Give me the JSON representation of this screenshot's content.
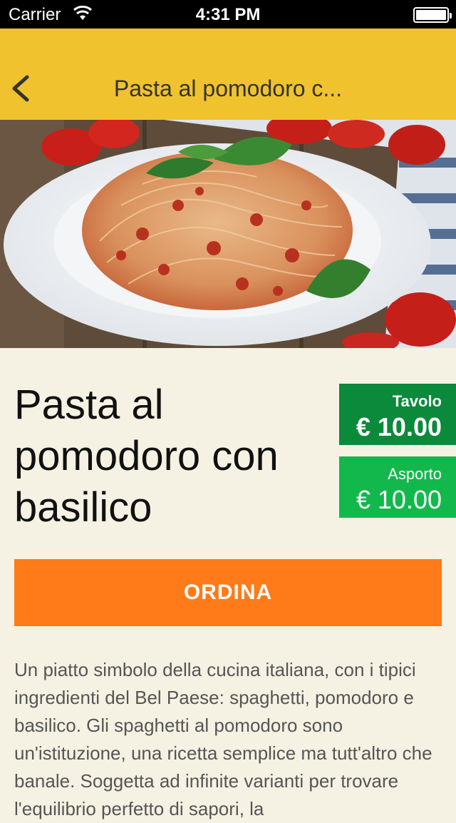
{
  "status_bar": {
    "carrier": "Carrier",
    "time": "4:31 PM"
  },
  "nav": {
    "title": "Pasta al pomodoro c...",
    "back_icon": "chevron-left-icon"
  },
  "hero": {
    "image_alt": ""
  },
  "dish": {
    "title": "Pasta al pomodoro con basilico"
  },
  "prices": {
    "table": {
      "label": "Tavolo",
      "value": "€ 10.00"
    },
    "takeaway": {
      "label": "Asporto",
      "value": "€ 10.00"
    }
  },
  "order_button": {
    "label": "ORDINA"
  },
  "description": "Un piatto simbolo della cucina italiana, con i tipici ingredienti del Bel Paese: spaghetti, pomodoro e basilico. Gli spaghetti al pomodoro sono un'istituzione, una ricetta semplice ma tutt'altro che banale. Soggetta ad infinite varianti per trovare l'equilibrio perfetto di sapori, la",
  "colors": {
    "nav": "#f0c22d",
    "table_price": "#0a8a3a",
    "takeaway_price": "#12b84c",
    "order": "#ff7a18",
    "background": "#f6f2e3"
  }
}
